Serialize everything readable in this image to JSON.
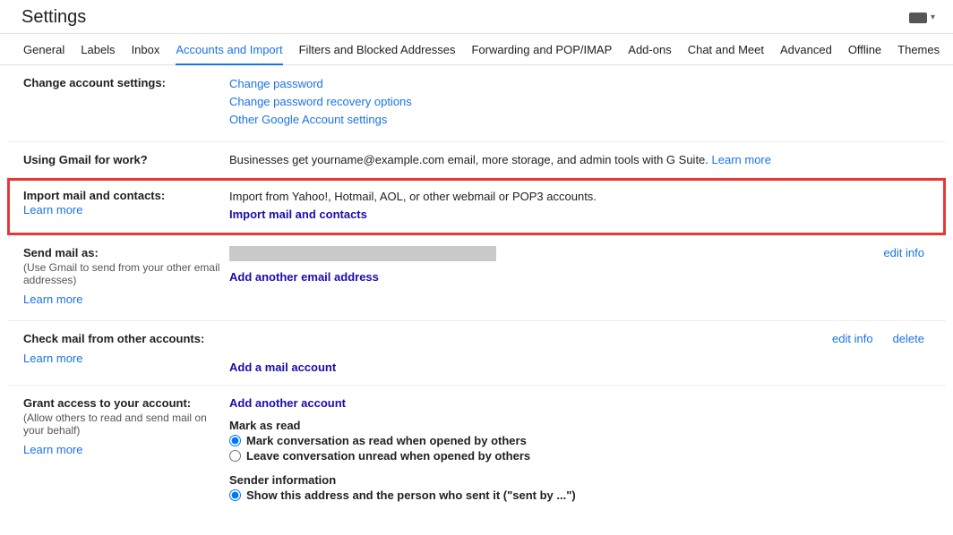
{
  "header": {
    "title": "Settings"
  },
  "tabs": [
    "General",
    "Labels",
    "Inbox",
    "Accounts and Import",
    "Filters and Blocked Addresses",
    "Forwarding and POP/IMAP",
    "Add-ons",
    "Chat and Meet",
    "Advanced",
    "Offline",
    "Themes"
  ],
  "activeTab": "Accounts and Import",
  "changeAccount": {
    "title": "Change account settings:",
    "links": [
      "Change password",
      "Change password recovery options",
      "Other Google Account settings"
    ]
  },
  "gmailWork": {
    "title": "Using Gmail for work?",
    "text": "Businesses get yourname@example.com email, more storage, and admin tools with G Suite. ",
    "learn": "Learn more"
  },
  "importMail": {
    "title": "Import mail and contacts:",
    "learn": "Learn more",
    "text": "Import from Yahoo!, Hotmail, AOL, or other webmail or POP3 accounts.",
    "action": "Import mail and contacts"
  },
  "sendMail": {
    "title": "Send mail as:",
    "sub": "(Use Gmail to send from your other email addresses)",
    "learn": "Learn more",
    "addAnother": "Add another email address",
    "editInfo": "edit info"
  },
  "checkMail": {
    "title": "Check mail from other accounts:",
    "learn": "Learn more",
    "addAccount": "Add a mail account",
    "editInfo": "edit info",
    "delete": "delete"
  },
  "grantAccess": {
    "title": "Grant access to your account:",
    "sub": "(Allow others to read and send mail on your behalf)",
    "learn": "Learn more",
    "addAnother": "Add another account",
    "markAsRead": "Mark as read",
    "opt1": "Mark conversation as read when opened by others",
    "opt2": "Leave conversation unread when opened by others",
    "senderInfo": "Sender information",
    "opt3": "Show this address and the person who sent it (\"sent by ...\")"
  }
}
